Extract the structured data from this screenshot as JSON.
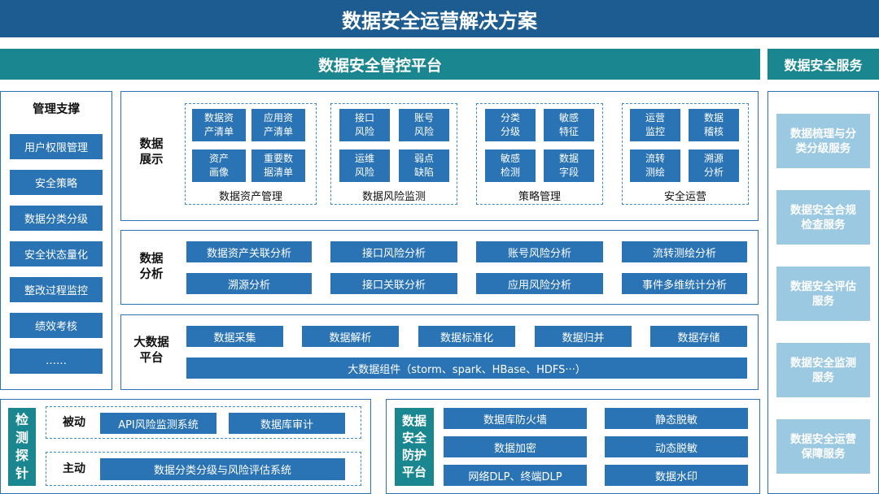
{
  "title": "数据安全运营解决方案",
  "platform_title": "数据安全管控平台",
  "service_title": "数据安全服务",
  "mgmt": {
    "title": "管理支撑",
    "items": [
      "用户权限管理",
      "安全策略",
      "数据分类分级",
      "安全状态量化",
      "整改过程监控",
      "绩效考核",
      "……"
    ]
  },
  "display": {
    "label": "数据\n展示",
    "groups": [
      {
        "caption": "数据资产管理",
        "items": [
          "数据资\n产清单",
          "应用资\n产清单",
          "资产\n画像",
          "重要数\n据清单"
        ]
      },
      {
        "caption": "数据风险监测",
        "items": [
          "接口\n风险",
          "账号\n风险",
          "运维\n风险",
          "弱点\n缺陷"
        ]
      },
      {
        "caption": "策略管理",
        "items": [
          "分类\n分级",
          "敏感\n特征",
          "敏感\n检测",
          "数据\n字段"
        ]
      },
      {
        "caption": "安全运营",
        "items": [
          "运营\n监控",
          "数据\n稽核",
          "流转\n测绘",
          "溯源\n分析"
        ]
      }
    ]
  },
  "analysis": {
    "label": "数据\n分析",
    "items": [
      "数据资产关联分析",
      "接口风险分析",
      "账号风险分析",
      "流转测绘分析",
      "溯源分析",
      "接口关联分析",
      "应用风险分析",
      "事件多维统计分析"
    ]
  },
  "bigdata": {
    "label": "大数据\n平台",
    "items": [
      "数据采集",
      "数据解析",
      "数据标准化",
      "数据归并",
      "数据存储"
    ],
    "component": "大数据组件（storm、spark、HBase、HDFS···）"
  },
  "probe": {
    "label": "检\n测\n探\n针",
    "passive_label": "被动",
    "passive_items": [
      "API风险监测系统",
      "数据库审计"
    ],
    "active_label": "主动",
    "active_item": "数据分类分级与风险评估系统"
  },
  "protect": {
    "label": "数据\n安全\n防护\n平台",
    "items": [
      "数据库防火墙",
      "静态脱敏",
      "数据加密",
      "动态脱敏",
      "网络DLP、终端DLP",
      "数据水印"
    ]
  },
  "services": [
    "数据梳理与分\n类分级服务",
    "数据安全合规\n检查服务",
    "数据安全评估\n服务",
    "数据安全监测\n服务",
    "数据安全运营\n保障服务"
  ]
}
